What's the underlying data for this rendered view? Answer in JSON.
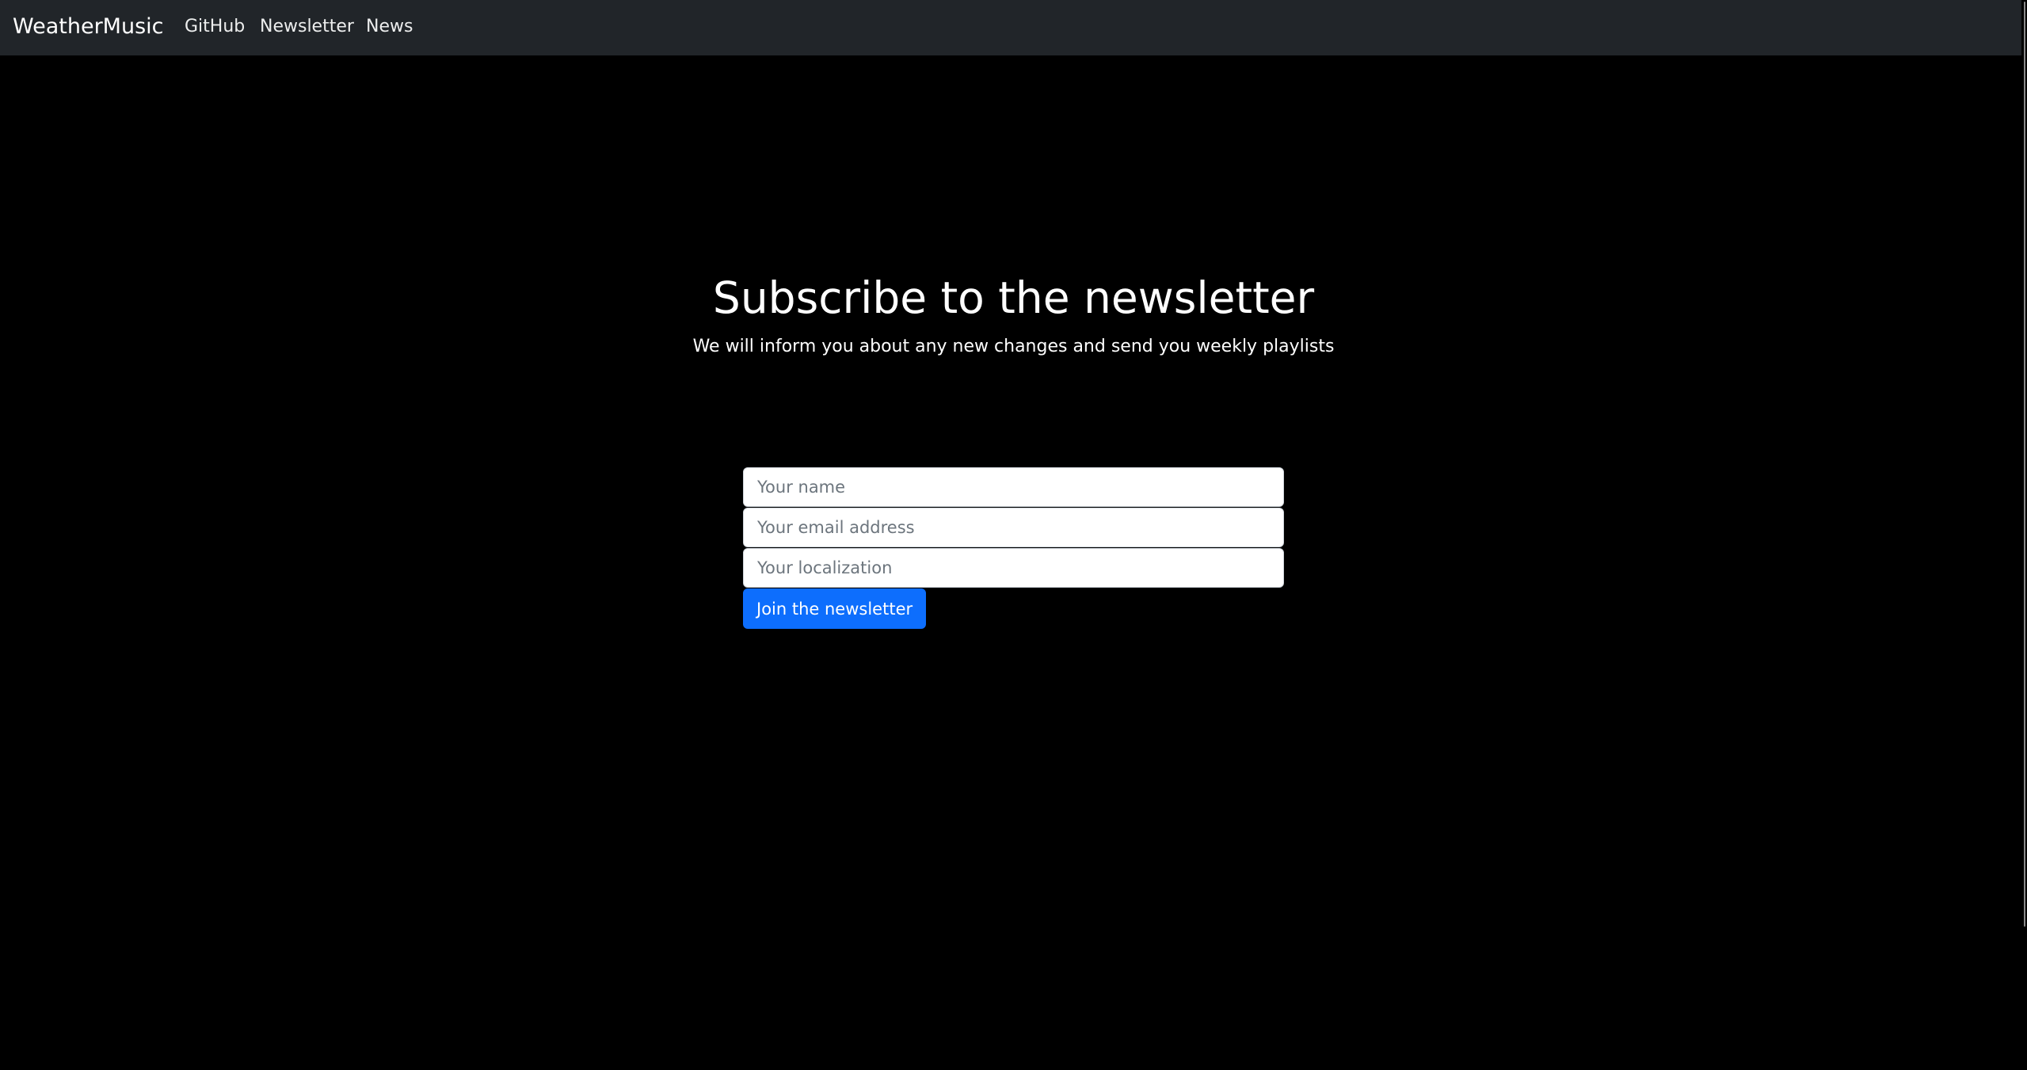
{
  "navbar": {
    "brand": "WeatherMusic",
    "links": [
      {
        "label": "GitHub"
      },
      {
        "label": "Newsletter"
      },
      {
        "label": "News"
      }
    ]
  },
  "hero": {
    "title": "Subscribe to the newsletter",
    "subtitle": "We will inform you about any new changes and send you weekly playlists"
  },
  "form": {
    "name_placeholder": "Your name",
    "name_value": "",
    "email_placeholder": "Your email address",
    "email_value": "",
    "location_placeholder": "Your localization",
    "location_value": "",
    "submit_label": "Join the newsletter"
  },
  "colors": {
    "page_background": "#000000",
    "navbar_background": "#212529",
    "primary_button": "#0d6efd"
  }
}
